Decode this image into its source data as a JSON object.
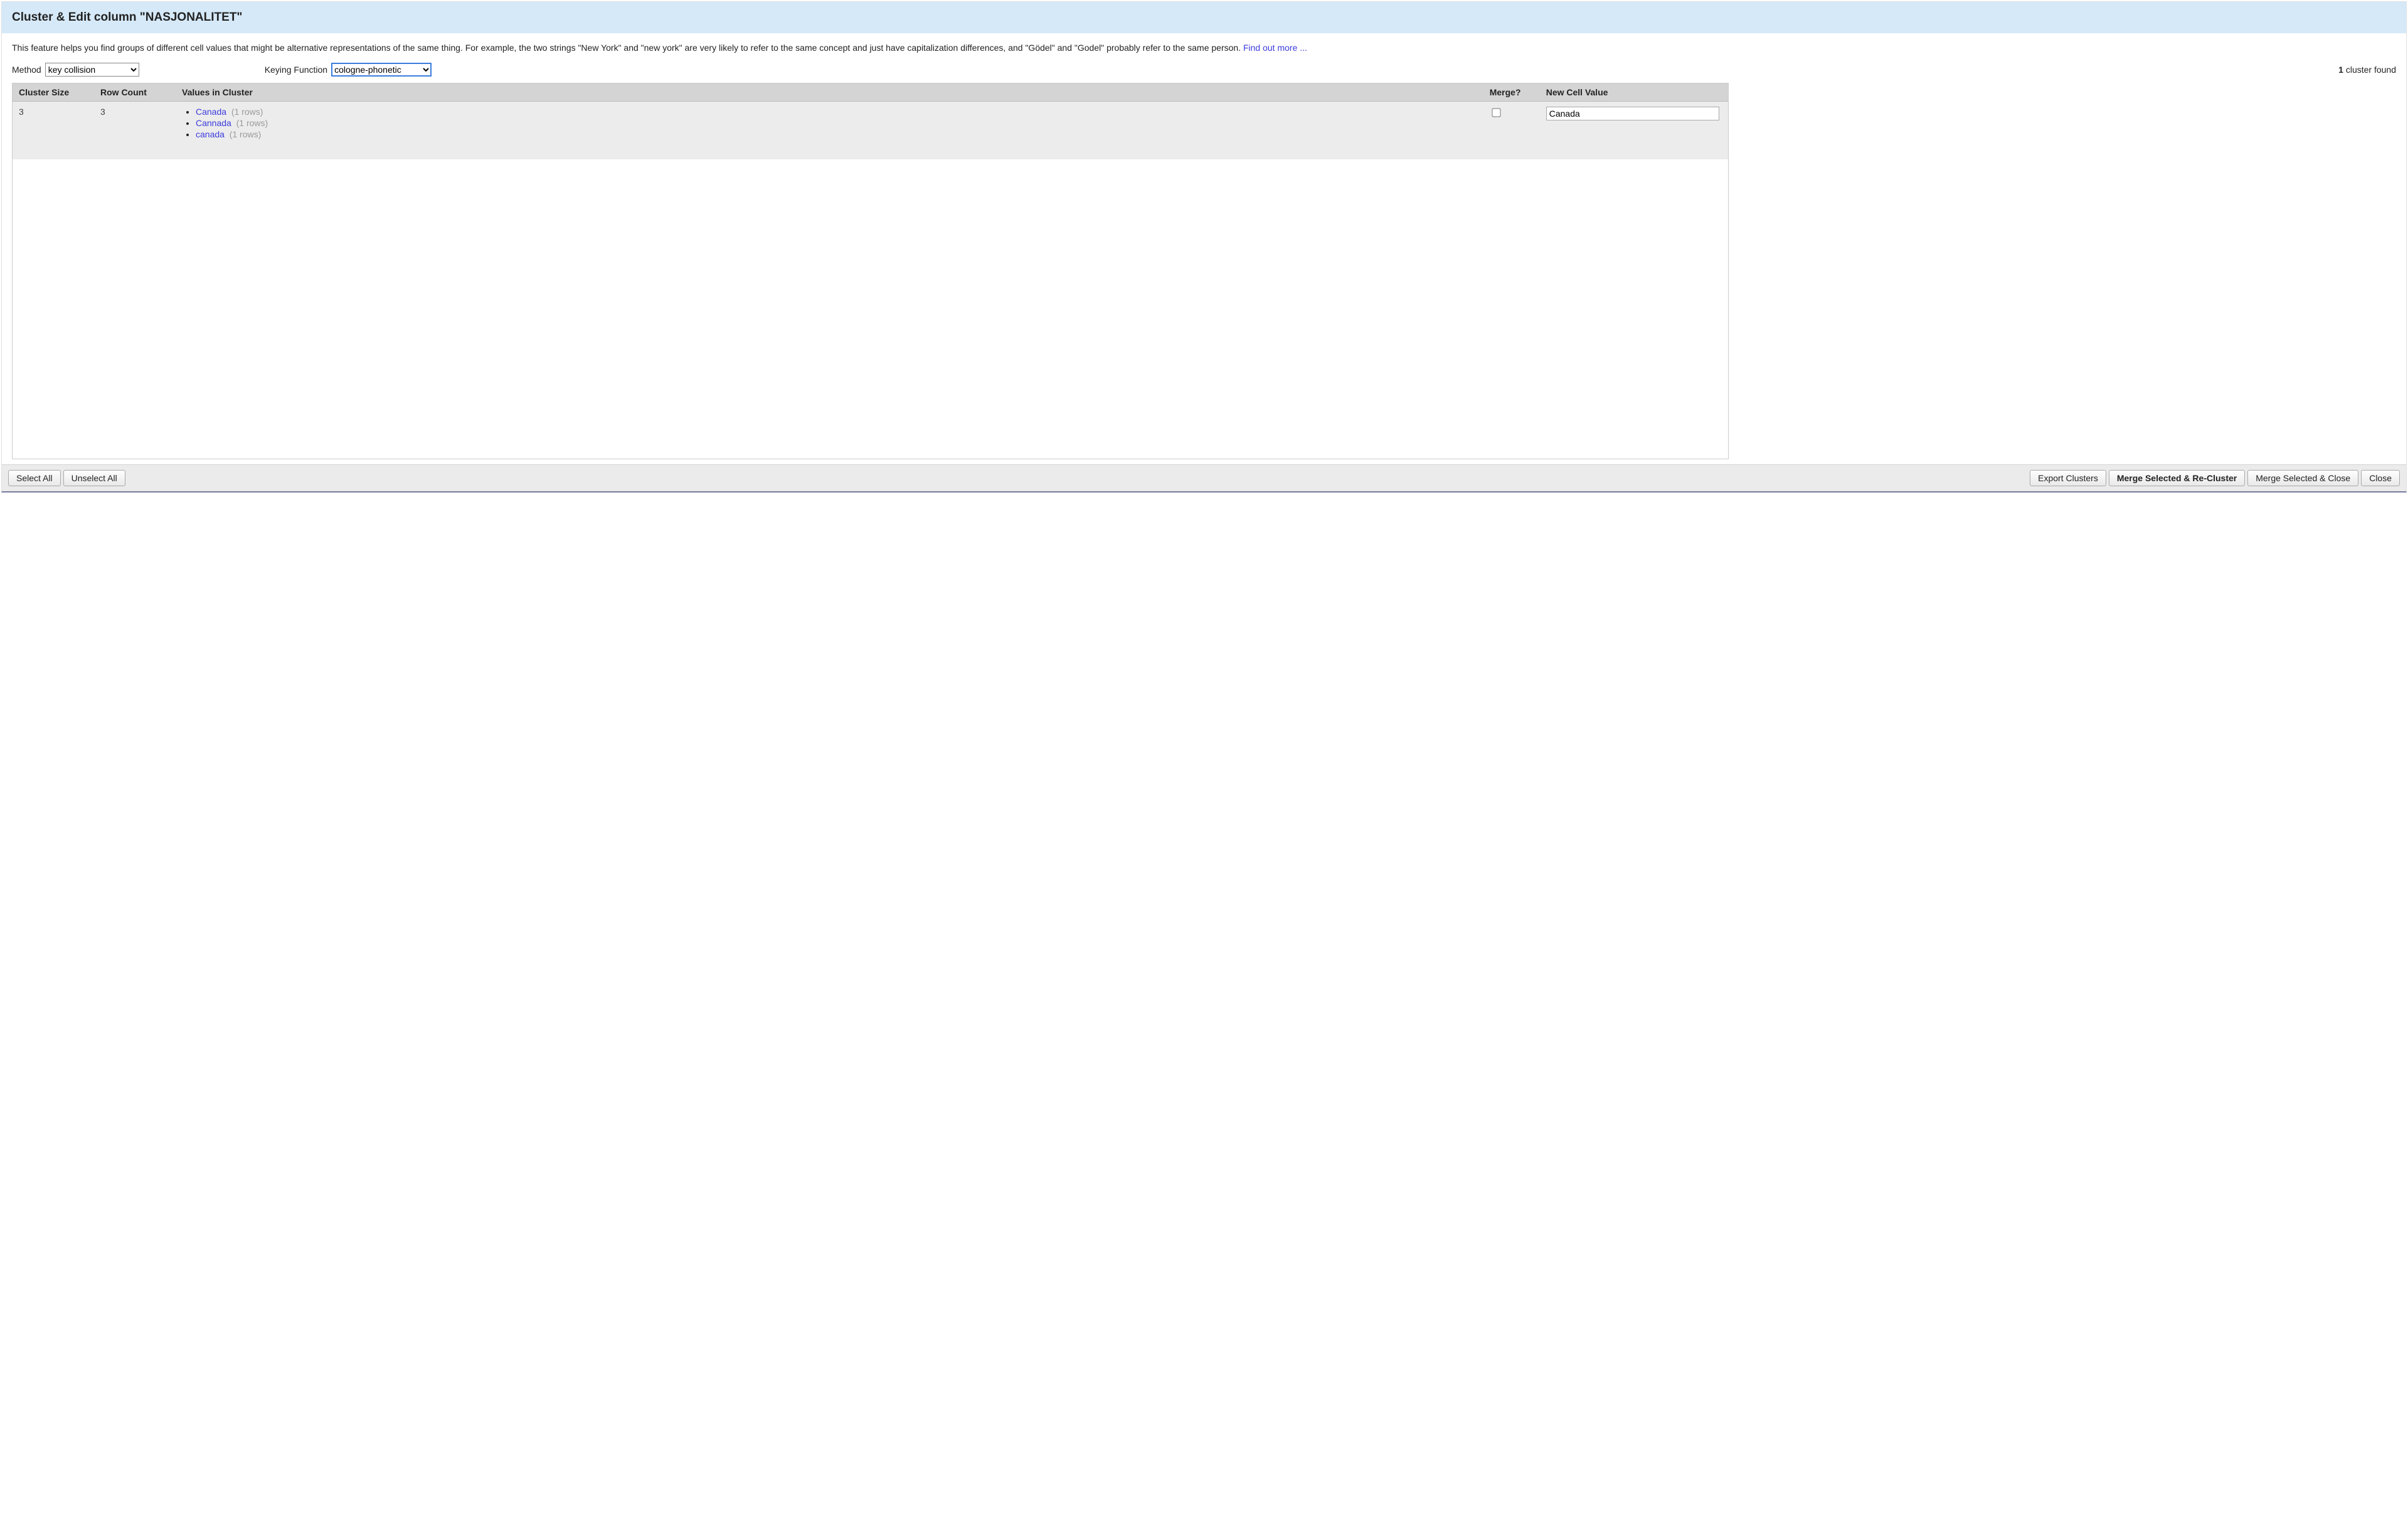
{
  "header": {
    "title": "Cluster & Edit column \"NASJONALITET\""
  },
  "description": {
    "text": "This feature helps you find groups of different cell values that might be alternative representations of the same thing. For example, the two strings \"New York\" and \"new york\" are very likely to refer to the same concept and just have capitalization differences, and \"Gödel\" and \"Godel\" probably refer to the same person. ",
    "link_text": "Find out more ..."
  },
  "controls": {
    "method_label": "Method",
    "method_value": "key collision",
    "keying_label": "Keying Function",
    "keying_value": "cologne-phonetic",
    "status_count": "1",
    "status_suffix": " cluster found"
  },
  "table": {
    "headers": {
      "size": "Cluster Size",
      "rows": "Row Count",
      "values": "Values in Cluster",
      "merge": "Merge?",
      "newval": "New Cell Value"
    },
    "rows": [
      {
        "size": "3",
        "row_count": "3",
        "values": [
          {
            "name": "Canada",
            "count": "(1 rows)"
          },
          {
            "name": "Cannada",
            "count": "(1 rows)"
          },
          {
            "name": "canada",
            "count": "(1 rows)"
          }
        ],
        "new_value": "Canada"
      }
    ]
  },
  "footer": {
    "select_all": "Select All",
    "unselect_all": "Unselect All",
    "export": "Export Clusters",
    "merge_recluster": "Merge Selected & Re-Cluster",
    "merge_close": "Merge Selected & Close",
    "close": "Close"
  }
}
